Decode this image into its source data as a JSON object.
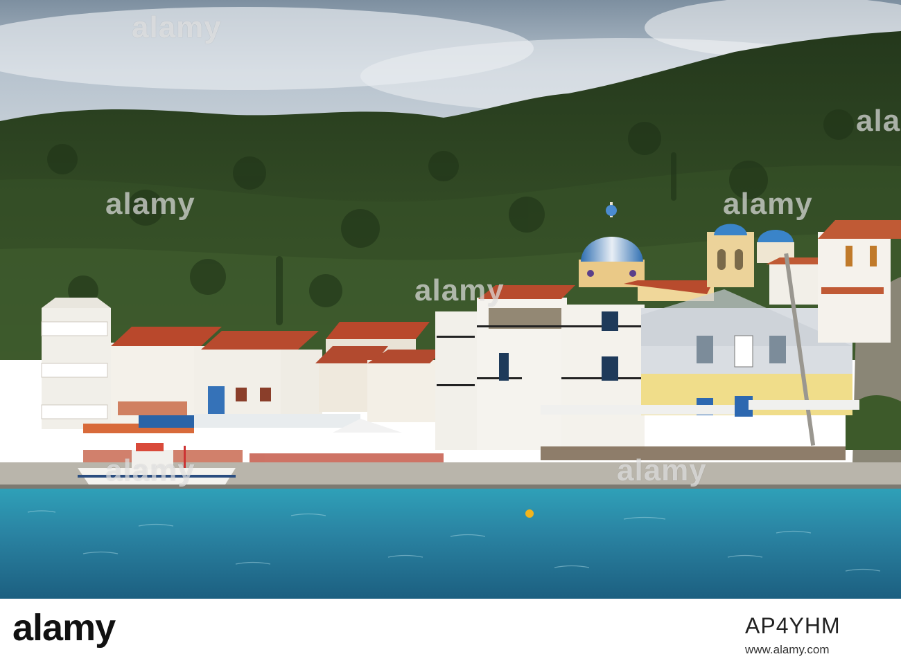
{
  "watermark": {
    "text": "alamy",
    "color": "#ffffff"
  },
  "footer": {
    "logo_text": "alamy",
    "image_id": "AP4YHM",
    "site": "www.alamy.com"
  },
  "colors": {
    "sky": "#c9d3dc",
    "hills": "#2f4a23",
    "sea": "#2a8fa6",
    "deep_sea": "#1f6f8c",
    "roof": "#b9482c",
    "dome": "#3a84c9",
    "walls": "#f2f0ea"
  }
}
